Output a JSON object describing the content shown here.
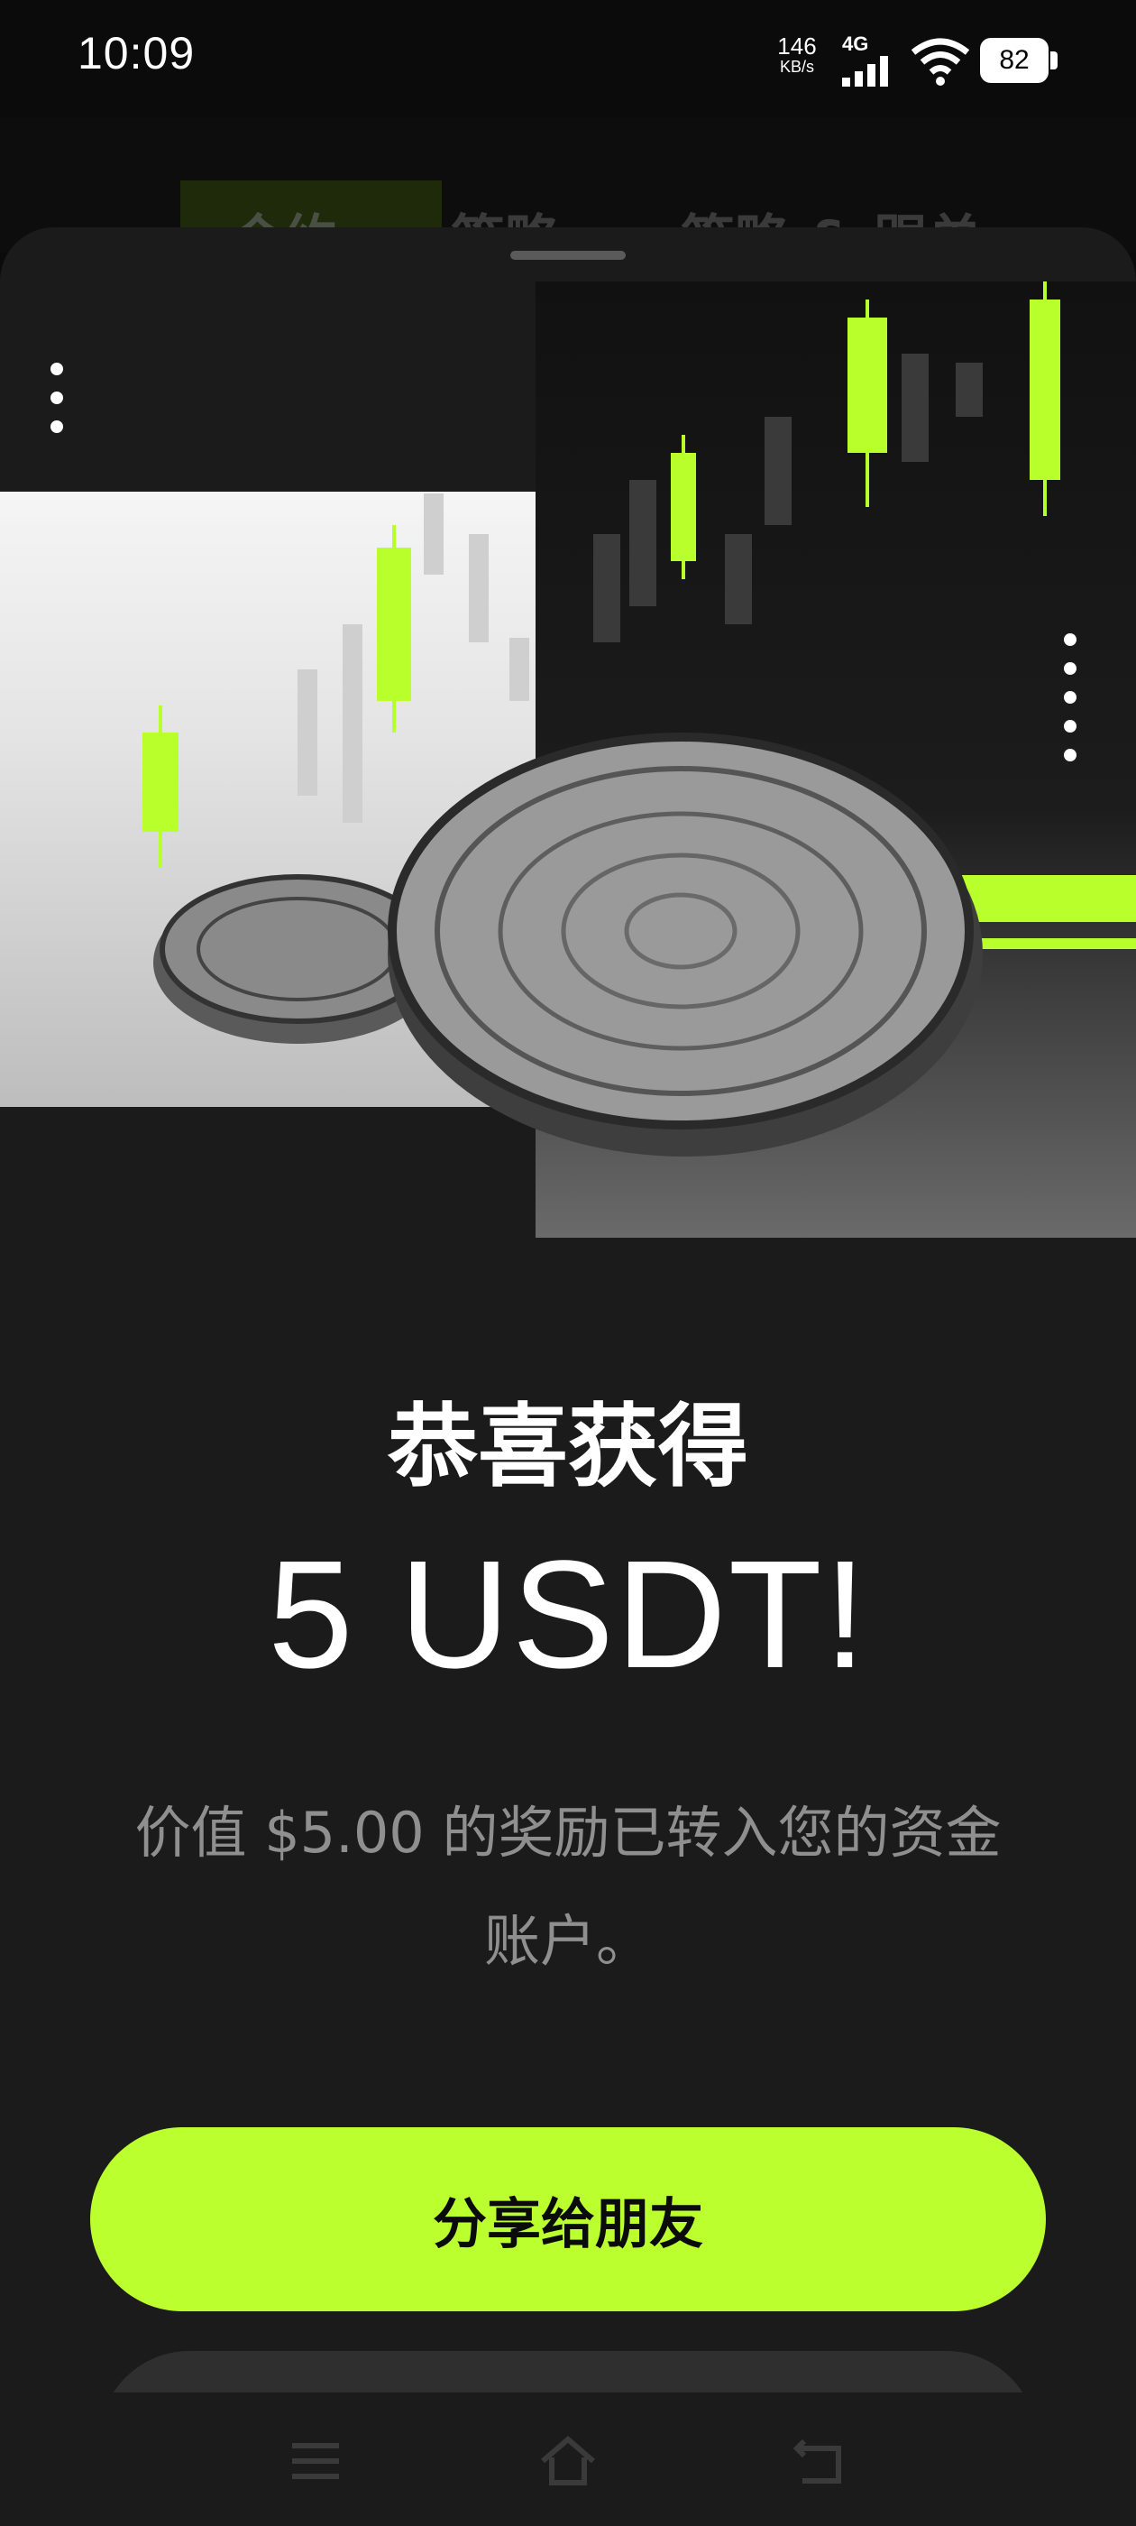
{
  "status_bar": {
    "time": "10:09",
    "net_speed_value": "146",
    "net_speed_unit": "KB/s",
    "net_type": "4G",
    "battery": "82"
  },
  "background_tabs": [
    "合约",
    "策略",
    "策略 & 跟单"
  ],
  "dialog": {
    "title": "恭喜获得",
    "amount": "5 USDT!",
    "description": "价值 $5.00 的奖励已转入您的资金账户。",
    "share_button": "分享给朋友"
  },
  "colors": {
    "accent": "#bbff2f",
    "sheet_background": "#1b1b1b",
    "description_text": "#8f8f8f"
  },
  "nav_bar": {
    "icons": [
      "menu-icon",
      "home-icon",
      "back-icon"
    ]
  }
}
